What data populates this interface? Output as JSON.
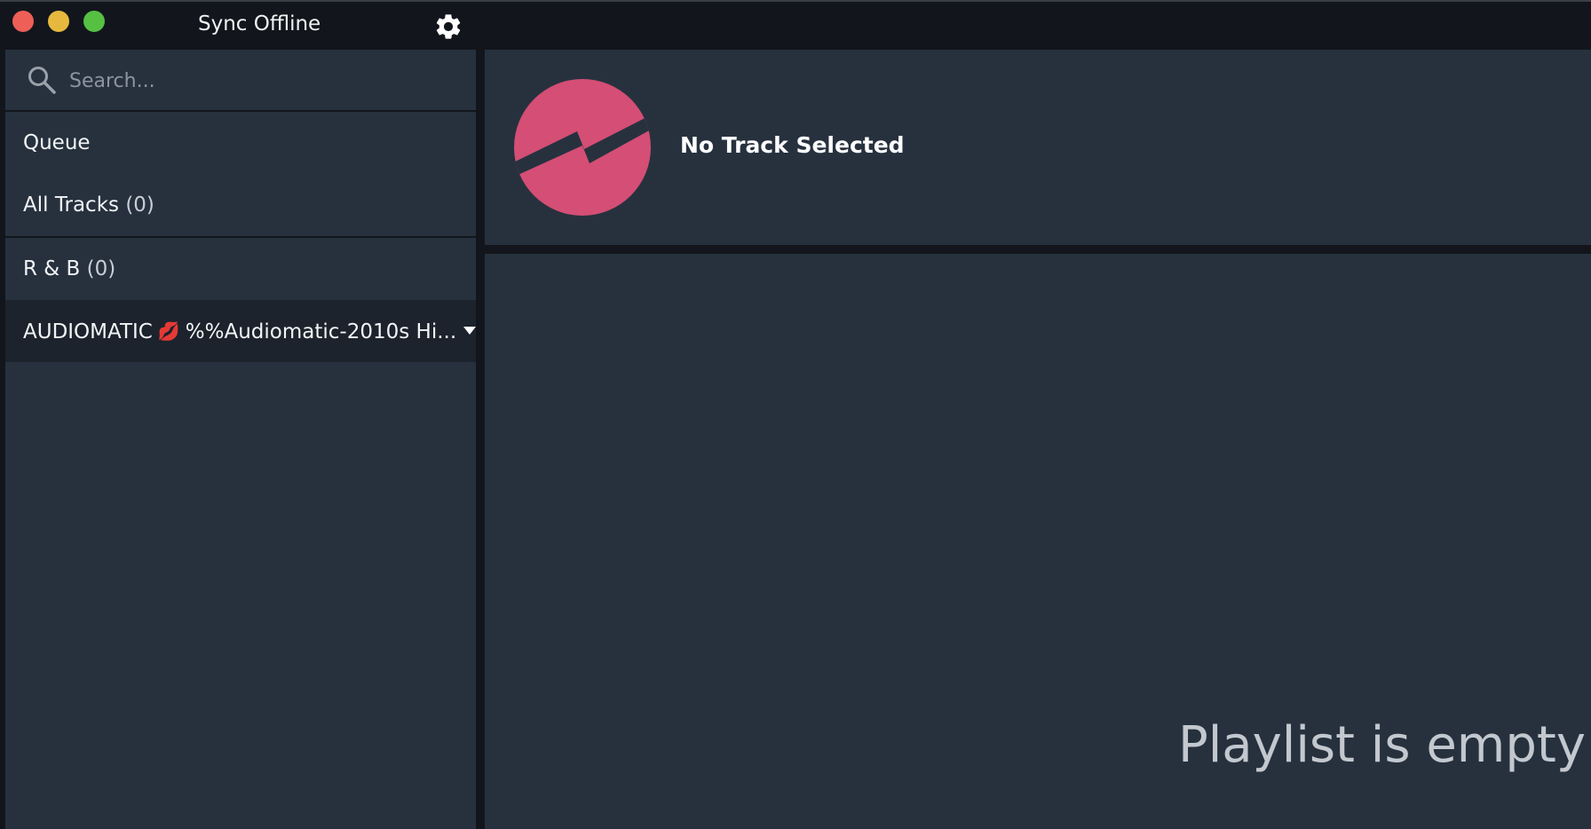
{
  "window": {
    "title": "Sync Offline",
    "traffic_lights": {
      "close_color": "#ee5f57",
      "minimize_color": "#e6b93e",
      "maximize_color": "#56c043"
    },
    "settings_icon": "gear-icon"
  },
  "sidebar": {
    "search": {
      "placeholder": "Search...",
      "value": "",
      "icon": "search-icon"
    },
    "items": [
      {
        "label": "Queue",
        "count": ""
      },
      {
        "label": "All Tracks",
        "count": "(0)"
      },
      {
        "label": "R & B",
        "count": "(0)"
      },
      {
        "label": "AUDIOMATIC",
        "emoji_icon": "kiss-mark-icon",
        "label_rest": "%%Audiomatic-2010s Hi...",
        "active": true
      }
    ]
  },
  "now_playing": {
    "title": "No Track Selected",
    "logo_color": "#d44e75"
  },
  "playlist": {
    "empty_message": "Playlist is empty"
  }
}
